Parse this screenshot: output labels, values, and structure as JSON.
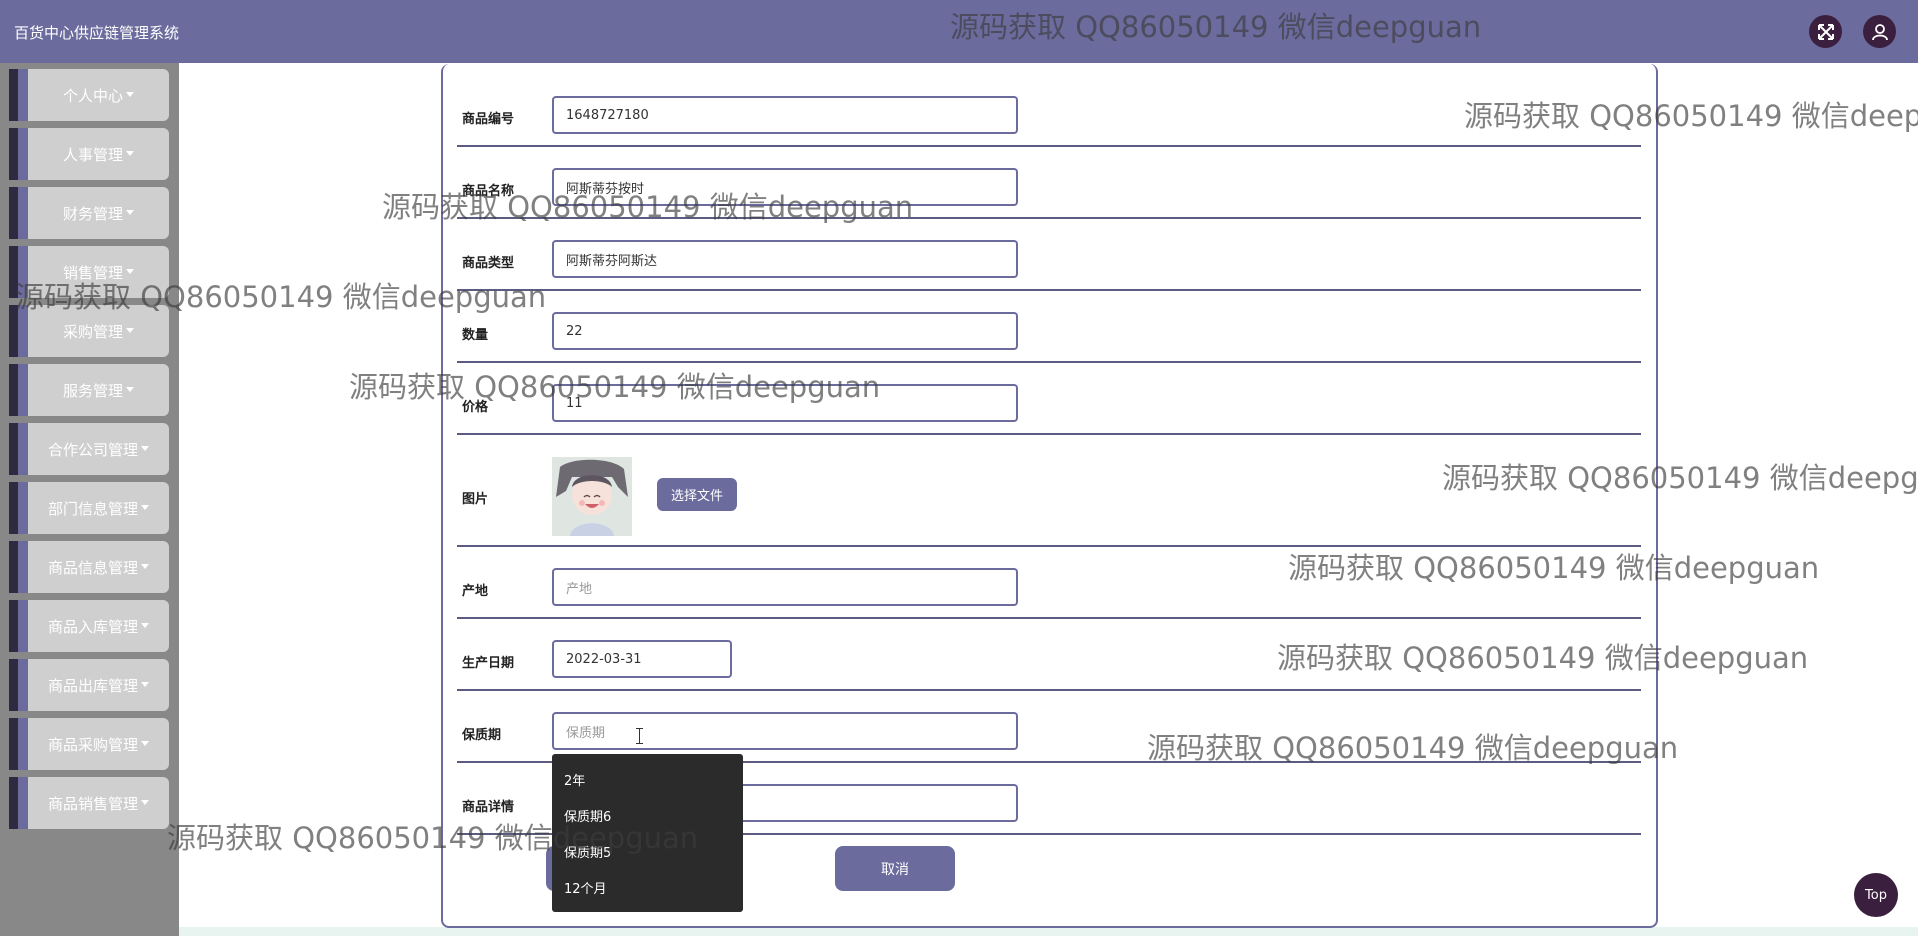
{
  "header": {
    "title": "百货中心供应链管理系统",
    "fullscreen_icon": "expand-arrows-icon",
    "user_icon": "user-icon",
    "color": "#6b6b9e"
  },
  "sidebar": {
    "items": [
      {
        "label": "个人中心"
      },
      {
        "label": "人事管理"
      },
      {
        "label": "财务管理"
      },
      {
        "label": "销售管理"
      },
      {
        "label": "采购管理"
      },
      {
        "label": "服务管理"
      },
      {
        "label": "合作公司管理"
      },
      {
        "label": "部门信息管理"
      },
      {
        "label": "商品信息管理"
      },
      {
        "label": "商品入库管理"
      },
      {
        "label": "商品出库管理"
      },
      {
        "label": "商品采购管理"
      },
      {
        "label": "商品销售管理"
      }
    ]
  },
  "form": {
    "product_id": {
      "label": "商品编号",
      "value": "1648727180"
    },
    "product_name": {
      "label": "商品名称",
      "value": "阿斯蒂芬按时"
    },
    "product_type": {
      "label": "商品类型",
      "value": "阿斯蒂芬阿斯达"
    },
    "quantity": {
      "label": "数量",
      "value": "22"
    },
    "price": {
      "label": "价格",
      "value": "11"
    },
    "image": {
      "label": "图片",
      "button": "选择文件"
    },
    "origin": {
      "label": "产地",
      "placeholder": "产地"
    },
    "production_date": {
      "label": "生产日期",
      "value": "2022-03-31"
    },
    "shelf_life": {
      "label": "保质期",
      "placeholder": "保质期"
    },
    "details": {
      "label": "商品详情"
    },
    "submit_label": "",
    "cancel_label": "取消"
  },
  "shelf_life_options": [
    "2年",
    "保质期6",
    "保质期5",
    "12个月"
  ],
  "top_button": "Top",
  "watermark": "源码获取 QQ86050149 微信deepguan"
}
